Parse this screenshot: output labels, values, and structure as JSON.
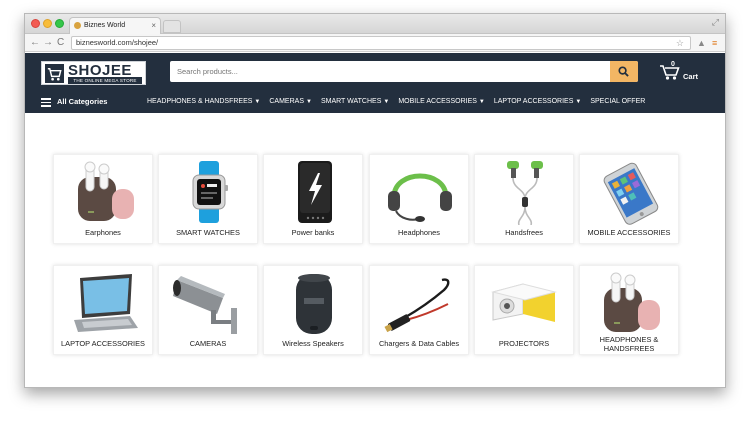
{
  "browser": {
    "tab_title": "Biznes World",
    "tab_close": "×",
    "url": "biznesworld.com/shojee/",
    "back_glyph": "←",
    "forward_glyph": "→",
    "reload_glyph": "C"
  },
  "site": {
    "logo_name": "SHOJEE",
    "logo_tagline": "THE ONLINE MEGA STORE",
    "search_placeholder": "Search products...",
    "cart_count": "0",
    "cart_label": "Cart",
    "all_categories": "All Categories",
    "menu": [
      {
        "label": "HEADPHONES & HANDSFREES",
        "caret": "▼"
      },
      {
        "label": "CAMERAS",
        "caret": "▼"
      },
      {
        "label": "SMART WATCHES",
        "caret": "▼"
      },
      {
        "label": "MOBILE ACCESSORIES",
        "caret": "▼"
      },
      {
        "label": "LAPTOP ACCESSORIES",
        "caret": "▼"
      },
      {
        "label": "SPECIAL OFFER",
        "caret": ""
      }
    ]
  },
  "categories": [
    {
      "label": "Earphones",
      "icon": "earbuds-case-icon"
    },
    {
      "label": "SMART WATCHES",
      "icon": "smartwatch-icon"
    },
    {
      "label": "Power banks",
      "icon": "power-bank-icon"
    },
    {
      "label": "Headphones",
      "icon": "headset-icon"
    },
    {
      "label": "Handsfrees",
      "icon": "wired-earphones-icon"
    },
    {
      "label": "MOBILE ACCESSORIES",
      "icon": "smartphone-icon"
    },
    {
      "label": "LAPTOP ACCESSORIES",
      "icon": "laptop-icon"
    },
    {
      "label": "CAMERAS",
      "icon": "cctv-camera-icon"
    },
    {
      "label": "Wireless Speakers",
      "icon": "speaker-icon"
    },
    {
      "label": "Chargers & Data Cables",
      "icon": "cable-icon"
    },
    {
      "label": "PROJECTORS",
      "icon": "projector-icon"
    },
    {
      "label": "HEADPHONES & HANDSFREES",
      "label_line1": "HEADPHONES &",
      "label_line2": "HANDSFREES",
      "icon": "earbuds-case-icon"
    }
  ],
  "colors": {
    "header_bg": "#232f3e",
    "search_button": "#f3b664",
    "accent_green": "#6cbf4a"
  }
}
